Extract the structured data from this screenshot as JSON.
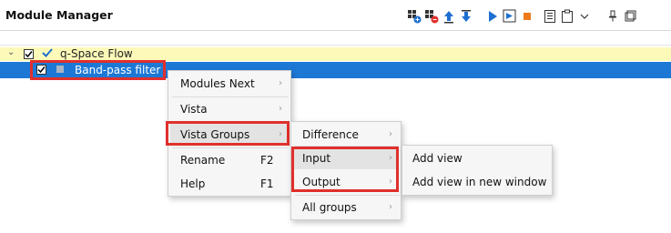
{
  "header": {
    "title": "Module Manager"
  },
  "toolbar": {
    "icons": [
      "add-module-icon",
      "remove-module-icon",
      "move-up-icon",
      "move-down-icon",
      "run-icon",
      "run-step-icon",
      "stop-icon",
      "list-icon",
      "clipboard-icon",
      "more-dropdown-icon",
      "pin-icon",
      "restore-icon"
    ]
  },
  "tree": {
    "flow_label": "q-Space Flow",
    "selected_label": "Band-pass filter"
  },
  "menu_main": {
    "items": [
      {
        "label": "Modules Next"
      },
      {
        "label": "Vista"
      },
      {
        "label": "Vista Groups"
      },
      {
        "label": "Rename",
        "shortcut": "F2"
      },
      {
        "label": "Help",
        "shortcut": "F1"
      }
    ]
  },
  "menu_groups": {
    "items": [
      {
        "label": "Difference"
      },
      {
        "label": "Input"
      },
      {
        "label": "Output"
      },
      {
        "label": "All groups"
      }
    ]
  },
  "menu_input": {
    "items": [
      {
        "label": "Add view"
      },
      {
        "label": "Add view in new window"
      }
    ]
  },
  "colors": {
    "selection": "#1d78d5",
    "flow_row": "#fdfab9",
    "highlight_box": "#e0302c"
  }
}
